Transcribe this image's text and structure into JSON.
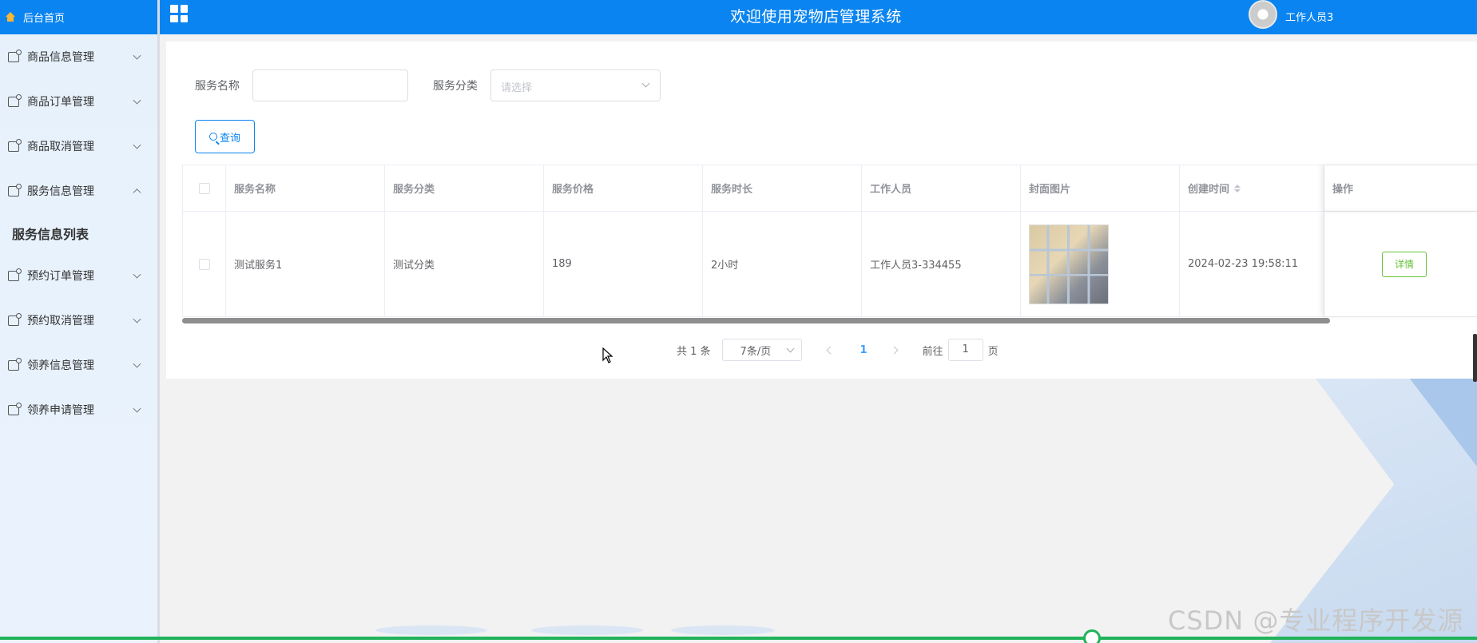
{
  "colors": {
    "primary": "#0a84f0",
    "success": "#67c23a",
    "progress": "#21b35a"
  },
  "sidebar": {
    "home_label": "后台首页",
    "items": [
      {
        "label": "商品信息管理",
        "expanded": false
      },
      {
        "label": "商品订单管理",
        "expanded": false
      },
      {
        "label": "商品取消管理",
        "expanded": false
      },
      {
        "label": "服务信息管理",
        "expanded": true
      },
      {
        "label": "预约订单管理",
        "expanded": false
      },
      {
        "label": "预约取消管理",
        "expanded": false
      },
      {
        "label": "领养信息管理",
        "expanded": false
      },
      {
        "label": "领养申请管理",
        "expanded": false
      }
    ],
    "submenu": {
      "label": "服务信息列表"
    }
  },
  "header": {
    "title": "欢迎使用宠物店管理系统",
    "user": "工作人员3"
  },
  "search": {
    "name_label": "服务名称",
    "name_value": "",
    "category_label": "服务分类",
    "category_placeholder": "请选择",
    "query_label": "查询"
  },
  "table": {
    "columns": [
      "服务名称",
      "服务分类",
      "服务价格",
      "服务时长",
      "工作人员",
      "封面图片",
      "创建时间",
      "操作"
    ],
    "rows": [
      {
        "name": "测试服务1",
        "category": "测试分类",
        "price": "189",
        "duration": "2小时",
        "staff": "工作人员3-334455",
        "created": "2024-02-23 19:58:11",
        "action": "详情"
      }
    ]
  },
  "pagination": {
    "total": "共 1 条",
    "page_size": "7条/页",
    "current": "1",
    "goto_label": "前往",
    "goto_value": "1",
    "page_suffix": "页"
  },
  "watermark": "CSDN @专业程序开发源"
}
